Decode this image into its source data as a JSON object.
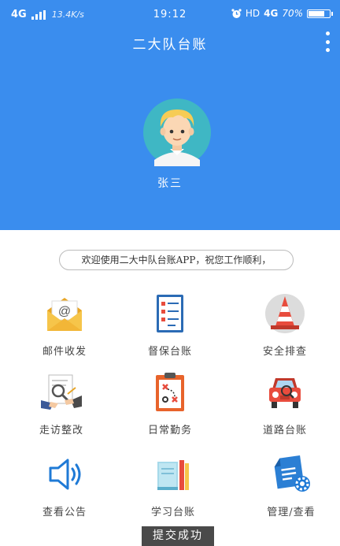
{
  "status_bar": {
    "network": "4G",
    "speed": "13.4K/s",
    "time": "19:12",
    "hd": "HD",
    "network2": "4G",
    "battery": "70%",
    "battery_level": 0.7
  },
  "header": {
    "title": "二大队台账",
    "username": "张三"
  },
  "welcome": "欢迎使用二大中队台账APP，祝您工作顺利，",
  "menu": [
    {
      "label": "邮件收发",
      "icon": "mail-icon"
    },
    {
      "label": "督保台账",
      "icon": "checklist-icon"
    },
    {
      "label": "安全排查",
      "icon": "traffic-cone-icon"
    },
    {
      "label": "走访整改",
      "icon": "inspection-icon"
    },
    {
      "label": "日常勤务",
      "icon": "clipboard-plan-icon"
    },
    {
      "label": "道路台账",
      "icon": "car-icon"
    },
    {
      "label": "查看公告",
      "icon": "speaker-icon"
    },
    {
      "label": "学习台账",
      "icon": "books-icon"
    },
    {
      "label": "管理/查看",
      "icon": "document-gear-icon"
    }
  ],
  "toast": "提交成功",
  "colors": {
    "header_bg": "#3a8dee"
  }
}
